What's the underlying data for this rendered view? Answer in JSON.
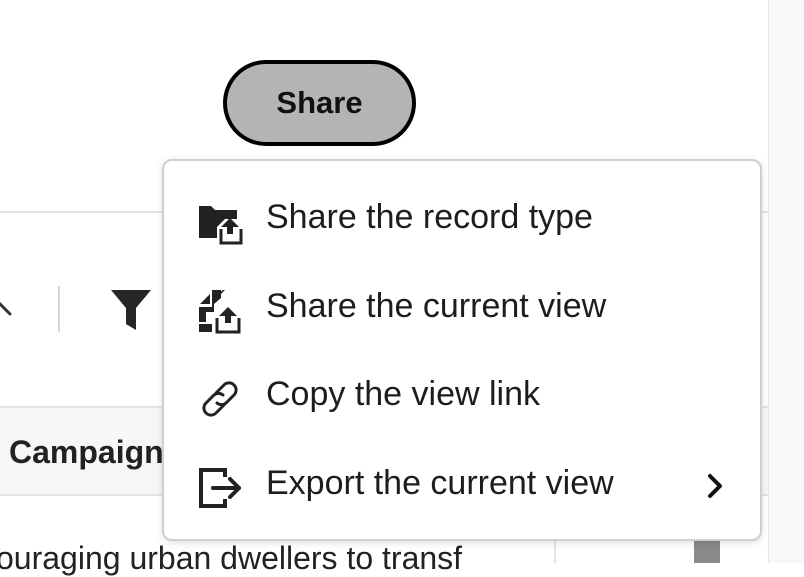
{
  "share_button": {
    "label": "Share"
  },
  "table": {
    "column_header": "Campaign",
    "row_text": "ouraging urban dwellers to transf"
  },
  "menu": {
    "items": [
      {
        "label": "Share the record type",
        "icon": "folder-share-icon",
        "has_submenu": false
      },
      {
        "label": "Share the current view",
        "icon": "view-share-icon",
        "has_submenu": false
      },
      {
        "label": "Copy the view link",
        "icon": "link-icon",
        "has_submenu": false
      },
      {
        "label": "Export the current view",
        "icon": "export-icon",
        "has_submenu": true
      }
    ]
  },
  "colors": {
    "button_fill": "#b4b4b4",
    "button_border": "#000000",
    "menu_border": "#cfcfcf",
    "icon": "#222222"
  }
}
